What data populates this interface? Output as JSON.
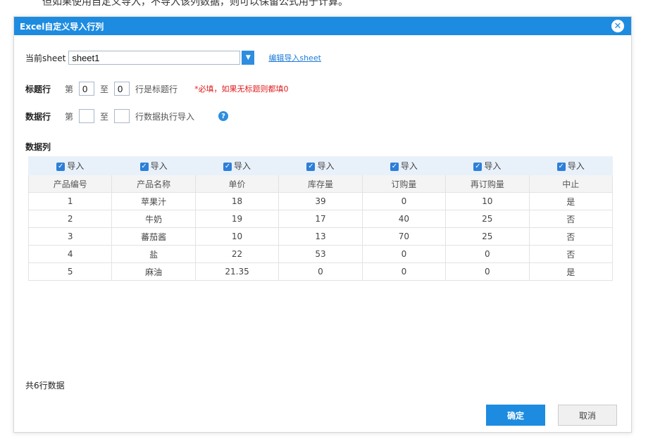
{
  "background_text": "但如果使用自定义导入，不导入该列数据，则可以保留公式用于计算。",
  "dialog": {
    "title": "Excel自定义导入行列",
    "close_icon": "close-circle-icon"
  },
  "sheet_row": {
    "label": "当前sheet",
    "value": "sheet1",
    "link": "编辑导入sheet"
  },
  "title_row": {
    "label": "标题行",
    "prefix": "第",
    "from": "0",
    "middle": "至",
    "to": "0",
    "suffix": "行是标题行",
    "hint": "*必填，如果无标题则都填0"
  },
  "data_row": {
    "label": "数据行",
    "prefix": "第",
    "from": "",
    "middle": "至",
    "to": "",
    "suffix": "行数据执行导入",
    "help": "?"
  },
  "columns_label": "数据列",
  "table": {
    "import_label": "导入",
    "headers": [
      "产品编号",
      "产品名称",
      "单价",
      "库存量",
      "订购量",
      "再订购量",
      "中止"
    ],
    "rows": [
      [
        "1",
        "苹果汁",
        "18",
        "39",
        "0",
        "10",
        "是"
      ],
      [
        "2",
        "牛奶",
        "19",
        "17",
        "40",
        "25",
        "否"
      ],
      [
        "3",
        "蕃茄酱",
        "10",
        "13",
        "70",
        "25",
        "否"
      ],
      [
        "4",
        "盐",
        "22",
        "53",
        "0",
        "0",
        "否"
      ],
      [
        "5",
        "麻油",
        "21.35",
        "0",
        "0",
        "0",
        "是"
      ]
    ]
  },
  "footer": {
    "count_text": "共6行数据",
    "ok": "确定",
    "cancel": "取消"
  },
  "colors": {
    "accent": "#1d8ce0",
    "hint_red": "#e02020"
  }
}
